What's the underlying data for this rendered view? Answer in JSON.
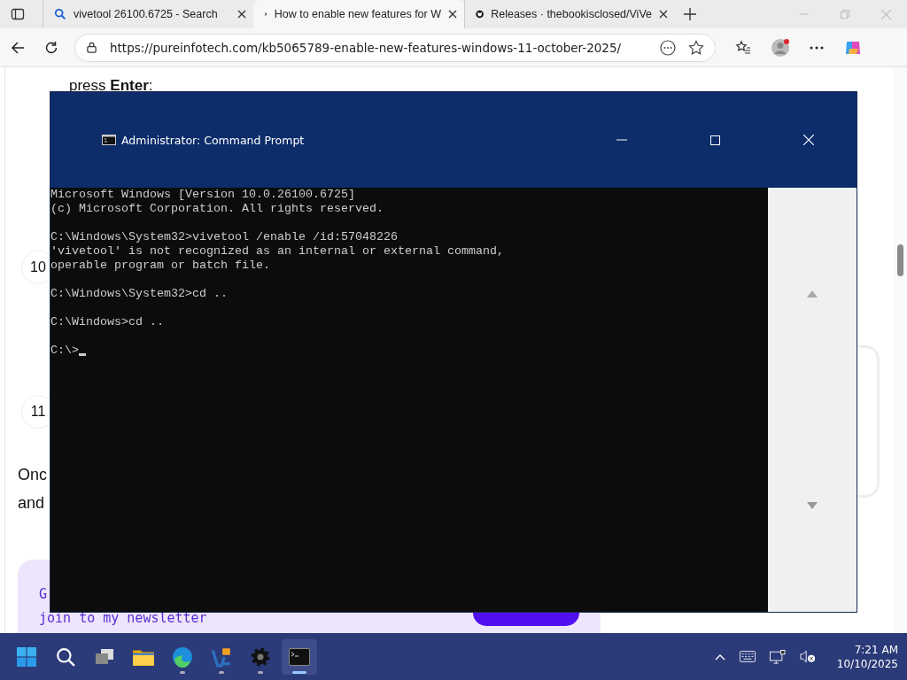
{
  "browser": {
    "tabs": [
      {
        "title": "vivetool 26100.6725 - Search",
        "kind": "search",
        "selected": false
      },
      {
        "title": "How to enable new features for W",
        "kind": "article",
        "selected": true
      },
      {
        "title": "Releases · thebookisclosed/ViVe",
        "kind": "repo",
        "selected": false
      }
    ],
    "url": "https://pureinfotech.com/kb5065789-enable-new-features-windows-11-october-2025/"
  },
  "page": {
    "instruction": "press **Enter**:",
    "steps": [
      "10",
      "11"
    ],
    "paragraph_lines": [
      "Onc",
      "and"
    ],
    "newsletter": {
      "heading": "G",
      "text": "join to my newsletter"
    }
  },
  "console_window": {
    "title": "Administrator: Command Prompt",
    "blocks": [
      [
        "Microsoft Windows [Version 10.0.26100.6725]",
        "(c) Microsoft Corporation. All rights reserved."
      ],
      [
        "C:\\Windows\\System32>vivetool /enable /id:57048226",
        "'vivetool' is not recognized as an internal or external command,",
        "operable program or batch file."
      ],
      [
        "C:\\Windows\\System32>cd .."
      ],
      [
        "C:\\Windows>cd .."
      ],
      [
        "C:\\>"
      ]
    ],
    "cursor": true
  },
  "taskbar": {
    "apps": [
      {
        "kind": "start",
        "running": false,
        "selected": false
      },
      {
        "kind": "search",
        "running": false,
        "selected": false
      },
      {
        "kind": "task-view",
        "running": false,
        "selected": false
      },
      {
        "kind": "folder",
        "running": false,
        "selected": false
      },
      {
        "kind": "browser",
        "running": true,
        "selected": false
      },
      {
        "kind": "app",
        "running": true,
        "selected": false
      },
      {
        "kind": "settings",
        "running": true,
        "selected": false
      },
      {
        "kind": "terminal",
        "running": true,
        "selected": true
      }
    ],
    "time": "7:21 AM",
    "date": "10/10/2025"
  }
}
